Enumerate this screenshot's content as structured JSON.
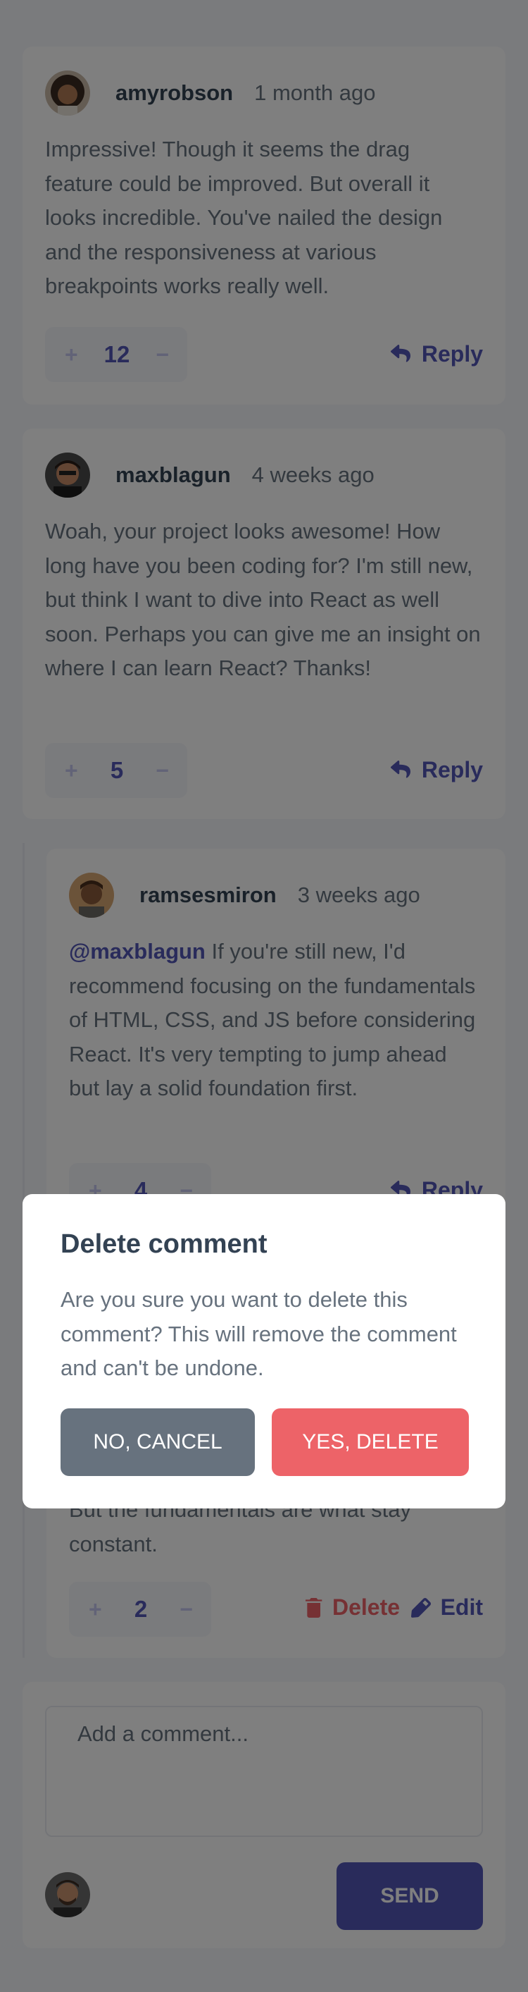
{
  "comments": [
    {
      "username": "amyrobson",
      "time": "1 month ago",
      "text": "Impressive! Though it seems the drag feature could be improved. But overall it looks incredible. You've nailed the design and the responsiveness at various breakpoints works really well.",
      "score": "12",
      "action": "Reply"
    },
    {
      "username": "maxblagun",
      "time": "4 weeks ago",
      "text": "Woah, your project looks awesome! How long have you been coding for? I'm still new, but think I want to dive into React as well soon. Perhaps you can give me an insight on where I can learn React? Thanks!",
      "score": "5",
      "action": "Reply"
    }
  ],
  "replies": [
    {
      "username": "ramsesmiron",
      "time": "3 weeks ago",
      "mention": "@maxblagun",
      "text": " If you're still new, I'd recommend focusing on the fundamentals of HTML, CSS, and JS before considering React. It's very tempting to jump ahead but lay a solid foundation first.",
      "score": "4",
      "action": "Reply"
    },
    {
      "text_visible": "But the fundamentals are what stay constant.",
      "score": "2",
      "delete_label": "Delete",
      "edit_label": "Edit"
    }
  ],
  "vote": {
    "plus": "+",
    "minus": "−"
  },
  "add_comment": {
    "placeholder": "Add a comment...",
    "send_label": "SEND"
  },
  "modal": {
    "title": "Delete comment",
    "text": "Are you sure you want to delete this comment? This will remove the comment and can't be undone.",
    "cancel_label": "NO, CANCEL",
    "confirm_label": "YES, DELETE"
  },
  "colors": {
    "primary": "#5357b6",
    "danger": "#ed6368",
    "neutral": "#67727e",
    "heading": "#334253",
    "background": "#f5f6fa"
  },
  "icons": [
    "reply-icon",
    "trash-icon",
    "pencil-icon"
  ]
}
